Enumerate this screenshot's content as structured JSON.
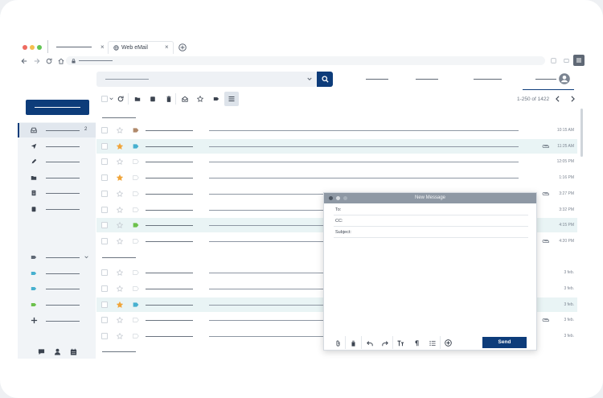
{
  "browser": {
    "tab_title": "Web eMail",
    "dot_colors": [
      "#ee6b60",
      "#f5be4f",
      "#62c554"
    ]
  },
  "toolbar": {
    "pagination": "1-250 of 1422"
  },
  "sidebar": {
    "inbox_count": "2"
  },
  "emails": [
    {
      "time": "10:15 AM",
      "starred": false,
      "highlight": false,
      "attach": false,
      "tag": "#b0896a"
    },
    {
      "time": "11:25 AM",
      "starred": true,
      "highlight": true,
      "attach": true,
      "tag": "#47b0cf"
    },
    {
      "time": "12:05 PM",
      "starred": false,
      "highlight": false,
      "attach": false,
      "tag": ""
    },
    {
      "time": "1:16 PM",
      "starred": true,
      "highlight": false,
      "attach": false,
      "tag": ""
    },
    {
      "time": "3:27 PM",
      "starred": false,
      "highlight": false,
      "attach": true,
      "tag": ""
    },
    {
      "time": "3:32 PM",
      "starred": false,
      "highlight": false,
      "attach": false,
      "tag": ""
    },
    {
      "time": "4:15 PM",
      "starred": false,
      "highlight": true,
      "attach": false,
      "tag": "#6cc14c"
    },
    {
      "time": "4:20 PM",
      "starred": false,
      "highlight": false,
      "attach": true,
      "tag": ""
    },
    {
      "time": "3 feb.",
      "starred": false,
      "highlight": false,
      "attach": false,
      "tag": ""
    },
    {
      "time": "3 feb.",
      "starred": false,
      "highlight": false,
      "attach": false,
      "tag": ""
    },
    {
      "time": "3 feb.",
      "starred": true,
      "highlight": true,
      "attach": false,
      "tag": "#47b0cf"
    },
    {
      "time": "3 feb.",
      "starred": false,
      "highlight": false,
      "attach": true,
      "tag": ""
    },
    {
      "time": "3 feb.",
      "starred": false,
      "highlight": false,
      "attach": false,
      "tag": ""
    }
  ],
  "compose": {
    "title": "New Message",
    "to_label": "To:",
    "cc_label": "CC:",
    "subject_label": "Subject:",
    "send_label": "Send"
  },
  "colors": {
    "brand": "#0d3c7a",
    "highlight_row": "#e9f4f5",
    "star": "#f0a53a"
  }
}
